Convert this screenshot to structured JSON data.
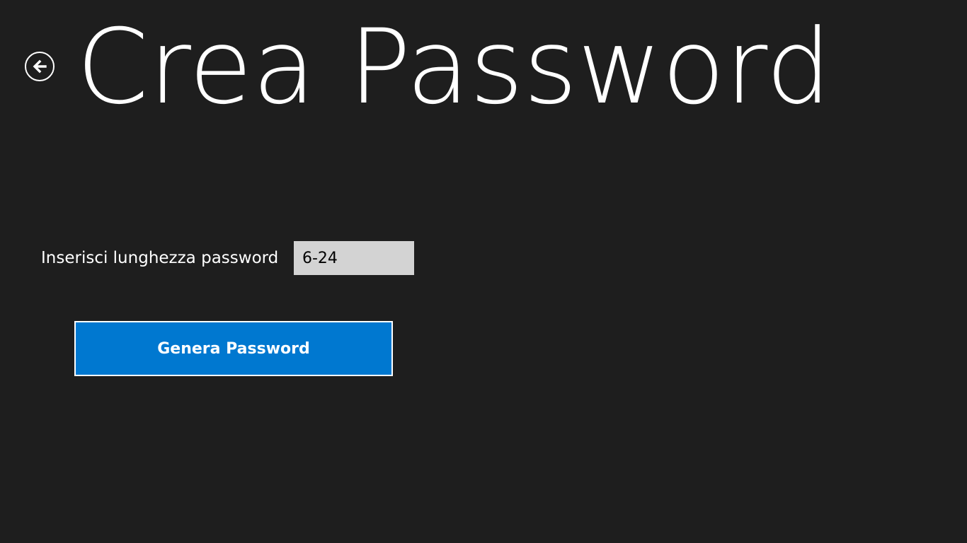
{
  "header": {
    "back_icon": "back-arrow-icon",
    "title": "Crea Password"
  },
  "form": {
    "length_label": "Inserisci lunghezza password",
    "length_input_value": "",
    "length_input_placeholder": "6-24",
    "generate_label": "Genera Password"
  },
  "colors": {
    "background": "#1e1e1e",
    "accent": "#0078d0",
    "input_background": "#d3d3d3",
    "text": "#ffffff"
  }
}
